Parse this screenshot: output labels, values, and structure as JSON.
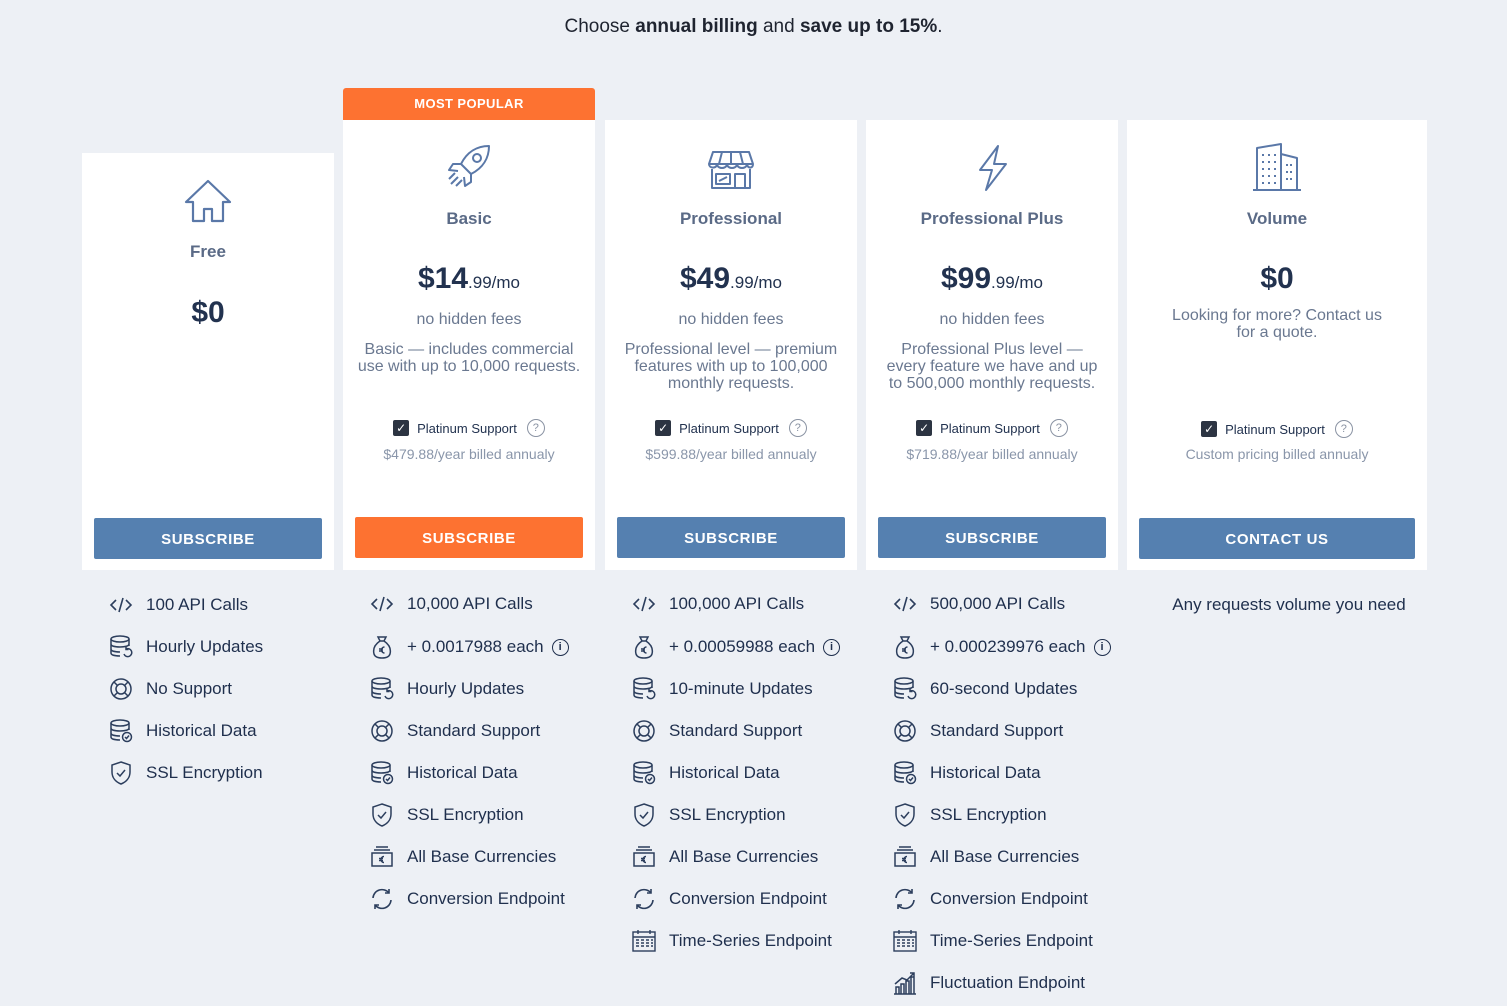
{
  "tagline": {
    "prefix": "Choose ",
    "bold1": "annual billing",
    "middle": " and ",
    "bold2": "save up to 15%",
    "suffix": "."
  },
  "colors": {
    "accent": "#fd7231",
    "primary": "#5580b0",
    "text": "#2c3e5d"
  },
  "plans": [
    {
      "icon": "house-icon",
      "name": "Free",
      "price_big": "$0",
      "price_small": "",
      "no_hidden": "",
      "desc": "",
      "support": "",
      "billed": "",
      "button": "SUBSCRIBE",
      "features": [
        {
          "icon": "code-icon",
          "label": "100 API Calls"
        },
        {
          "icon": "database-refresh-icon",
          "label": "Hourly Updates"
        },
        {
          "icon": "lifebuoy-icon",
          "label": "No Support"
        },
        {
          "icon": "database-check-icon",
          "label": "Historical Data"
        },
        {
          "icon": "shield-check-icon",
          "label": "SSL Encryption"
        }
      ]
    },
    {
      "icon": "rocket-icon",
      "badge": "MOST POPULAR",
      "name": "Basic",
      "price_big": "$14",
      "price_small": ".99/mo",
      "no_hidden": "no hidden fees",
      "desc": "Basic — includes commercial use with up to 10,000 requests.",
      "support": "Platinum Support",
      "billed": "$479.88/year billed annualy",
      "button": "SUBSCRIBE",
      "features": [
        {
          "icon": "code-icon",
          "label": "10,000 API Calls"
        },
        {
          "icon": "money-bag-euro-icon",
          "label": "+ 0.0017988 each",
          "info": "i"
        },
        {
          "icon": "database-refresh-icon",
          "label": "Hourly Updates"
        },
        {
          "icon": "lifebuoy-icon",
          "label": "Standard Support"
        },
        {
          "icon": "database-check-icon",
          "label": "Historical Data"
        },
        {
          "icon": "shield-check-icon",
          "label": "SSL Encryption"
        },
        {
          "icon": "currency-note-icon",
          "label": "All Base Currencies"
        },
        {
          "icon": "refresh-icon",
          "label": "Conversion Endpoint"
        }
      ]
    },
    {
      "icon": "store-icon",
      "name": "Professional",
      "price_big": "$49",
      "price_small": ".99/mo",
      "no_hidden": "no hidden fees",
      "desc": "Professional level — premium features with up to 100,000 monthly requests.",
      "support": "Platinum Support",
      "billed": "$599.88/year billed annualy",
      "button": "SUBSCRIBE",
      "features": [
        {
          "icon": "code-icon",
          "label": "100,000 API Calls"
        },
        {
          "icon": "money-bag-euro-icon",
          "label": "+ 0.00059988 each",
          "info": "i"
        },
        {
          "icon": "database-refresh-icon",
          "label": "10-minute Updates"
        },
        {
          "icon": "lifebuoy-icon",
          "label": "Standard Support"
        },
        {
          "icon": "database-check-icon",
          "label": "Historical Data"
        },
        {
          "icon": "shield-check-icon",
          "label": "SSL Encryption"
        },
        {
          "icon": "currency-note-icon",
          "label": "All Base Currencies"
        },
        {
          "icon": "refresh-icon",
          "label": "Conversion Endpoint"
        },
        {
          "icon": "calendar-icon",
          "label": "Time-Series Endpoint"
        }
      ]
    },
    {
      "icon": "lightning-icon",
      "name": "Professional Plus",
      "price_big": "$99",
      "price_small": ".99/mo",
      "no_hidden": "no hidden fees",
      "desc": "Professional Plus level — every feature we have and up to 500,000 monthly requests.",
      "support": "Platinum Support",
      "billed": "$719.88/year billed annualy",
      "button": "SUBSCRIBE",
      "features": [
        {
          "icon": "code-icon",
          "label": "500,000 API Calls"
        },
        {
          "icon": "money-bag-euro-icon",
          "label": "+ 0.000239976 each",
          "info": "i"
        },
        {
          "icon": "database-refresh-icon",
          "label": "60-second Updates"
        },
        {
          "icon": "lifebuoy-icon",
          "label": "Standard Support"
        },
        {
          "icon": "database-check-icon",
          "label": "Historical Data"
        },
        {
          "icon": "shield-check-icon",
          "label": "SSL Encryption"
        },
        {
          "icon": "currency-note-icon",
          "label": "All Base Currencies"
        },
        {
          "icon": "refresh-icon",
          "label": "Conversion Endpoint"
        },
        {
          "icon": "calendar-icon",
          "label": "Time-Series Endpoint"
        },
        {
          "icon": "bar-chart-icon",
          "label": "Fluctuation Endpoint"
        }
      ]
    },
    {
      "icon": "building-icon",
      "name": "Volume",
      "price_big": "$0",
      "price_small": "",
      "no_hidden": "",
      "desc": "Looking for more? Contact us for a quote.",
      "support": "Platinum Support",
      "billed": "Custom pricing billed annualy",
      "button": "CONTACT US",
      "any": "Any requests volume you need",
      "features": []
    }
  ]
}
